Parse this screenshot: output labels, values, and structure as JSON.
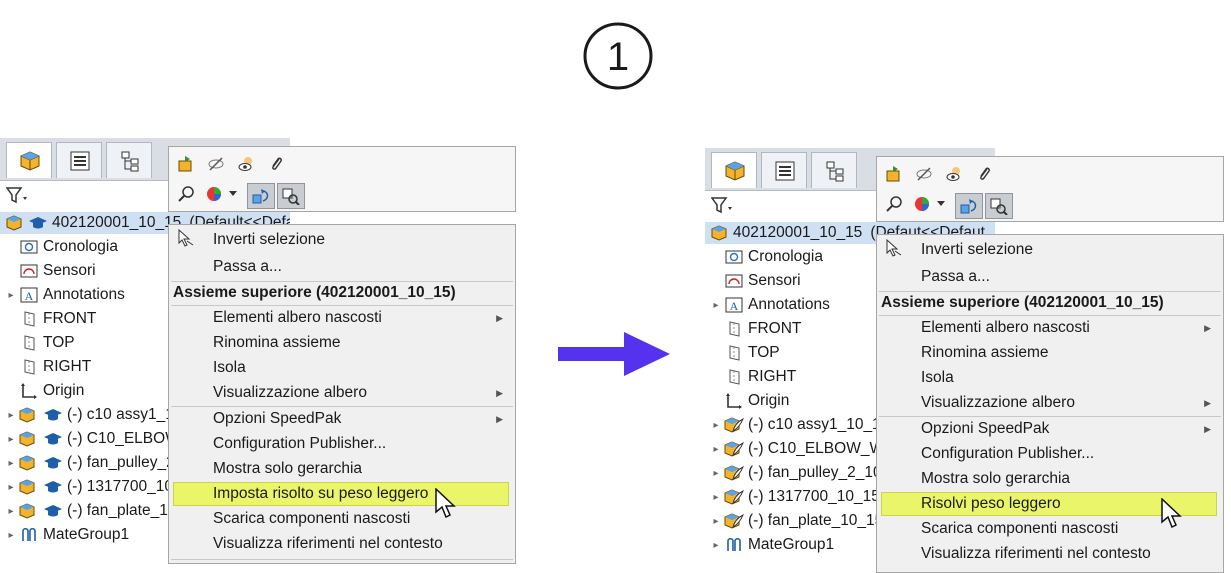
{
  "step_number": "1",
  "colors": {
    "highlight": "#eaf56a",
    "arrow": "#5533ee",
    "selection": "#cfe0f3"
  },
  "icons": {
    "tabs": [
      "feature-manager-icon",
      "property-manager-icon",
      "configuration-manager-icon"
    ],
    "toolbar": [
      "open-part-icon",
      "hide-icon",
      "show-icon",
      "attach-icon",
      "zoom-to-selection-icon",
      "appearance-icon",
      "isolate-icon",
      "component-config-icon"
    ]
  },
  "left": {
    "root_label": "402120001_10_15",
    "root_suffix": "(Default<<Defa",
    "tree": [
      {
        "label": "Cronologia"
      },
      {
        "label": "Sensori"
      },
      {
        "label": "Annotations"
      },
      {
        "label": "FRONT"
      },
      {
        "label": "TOP"
      },
      {
        "label": "RIGHT"
      },
      {
        "label": "Origin"
      },
      {
        "label": "(-) c10 assy1_1"
      },
      {
        "label": "(-) C10_ELBOW"
      },
      {
        "label": "(-) fan_pulley_2"
      },
      {
        "label": "(-) 1317700_10"
      },
      {
        "label": "(-) fan_plate_1"
      },
      {
        "label": "MateGroup1"
      }
    ],
    "menu": {
      "invert_selection": "Inverti selezione",
      "goto": "Passa a...",
      "header": "Assieme superiore (402120001_10_15)",
      "hidden_tree_items": "Elementi albero nascosti",
      "rename_assembly": "Rinomina assieme",
      "isolate": "Isola",
      "tree_display": "Visualizzazione albero",
      "speedpak": "Opzioni SpeedPak",
      "config_publisher": "Configuration Publisher...",
      "show_hierarchy": "Mostra solo gerarchia",
      "set_lightweight": "Imposta risolto su peso leggero",
      "unload_hidden": "Scarica componenti nascosti",
      "show_references": "Visualizza riferimenti nel contesto"
    }
  },
  "right": {
    "root_label": "402120001_10_15",
    "root_suffix": "(Defaut<<Defaut",
    "tree": [
      {
        "label": "Cronologia"
      },
      {
        "label": "Sensori"
      },
      {
        "label": "Annotations"
      },
      {
        "label": "FRONT"
      },
      {
        "label": "TOP"
      },
      {
        "label": "RIGHT"
      },
      {
        "label": "Origin"
      },
      {
        "label": "(-) c10 assy1_10_15"
      },
      {
        "label": "(-) C10_ELBOW_WA"
      },
      {
        "label": "(-) fan_pulley_2_10"
      },
      {
        "label": "(-) 1317700_10_15"
      },
      {
        "label": "(-) fan_plate_10_15"
      },
      {
        "label": "MateGroup1"
      }
    ],
    "menu": {
      "invert_selection": "Inverti selezione",
      "goto": "Passa a...",
      "header": "Assieme superiore (402120001_10_15)",
      "hidden_tree_items": "Elementi albero nascosti",
      "rename_assembly": "Rinomina assieme",
      "isolate": "Isola",
      "tree_display": "Visualizzazione albero",
      "speedpak": "Opzioni SpeedPak",
      "config_publisher": "Configuration Publisher...",
      "show_hierarchy": "Mostra solo gerarchia",
      "resolve_lightweight": "Risolvi peso leggero",
      "unload_hidden": "Scarica componenti nascosti",
      "show_references": "Visualizza riferimenti nel contesto"
    }
  }
}
